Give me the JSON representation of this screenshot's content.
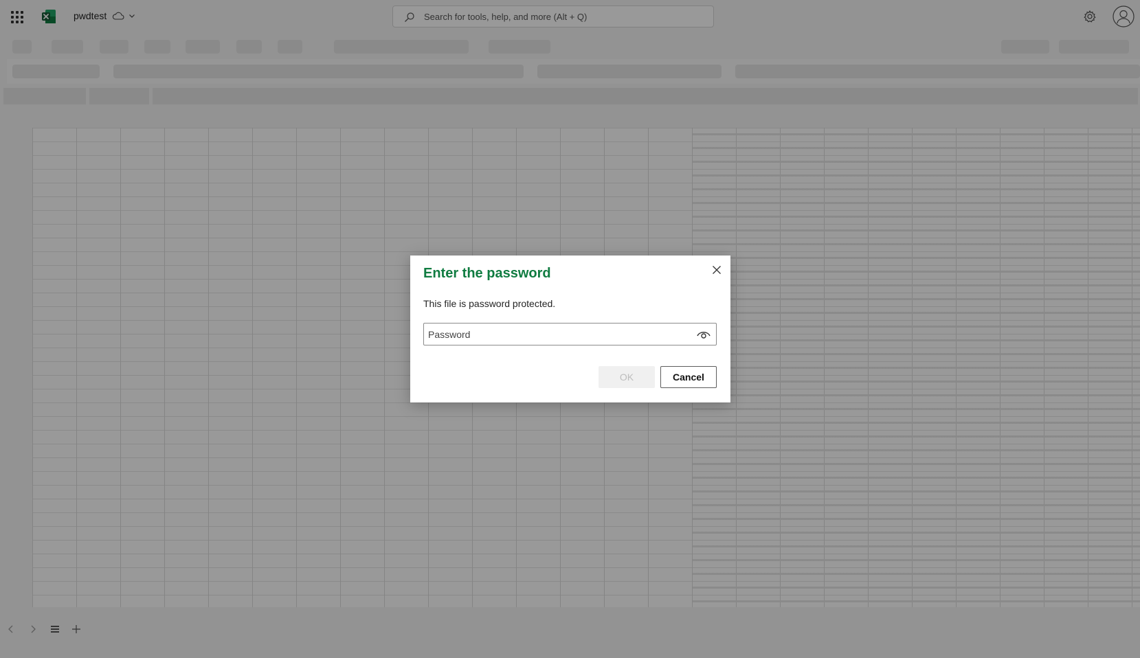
{
  "app": {
    "document_title": "pwdtest",
    "search_placeholder": "Search for tools, help, and more (Alt + Q)",
    "brand_color": "#107C41"
  },
  "dialog": {
    "title": "Enter the password",
    "message": "This file is password protected.",
    "password_placeholder": "Password",
    "password_value": "",
    "ok_label": "OK",
    "cancel_label": "Cancel",
    "ok_enabled": false
  },
  "icons": {
    "waffle": "app-launcher-icon",
    "excel": "excel-logo-icon",
    "cloud": "cloud-icon",
    "chevron": "chevron-down-icon",
    "search": "search-icon",
    "settings": "gear-icon",
    "account": "account-icon",
    "close": "close-icon",
    "show_password": "eye-icon"
  }
}
